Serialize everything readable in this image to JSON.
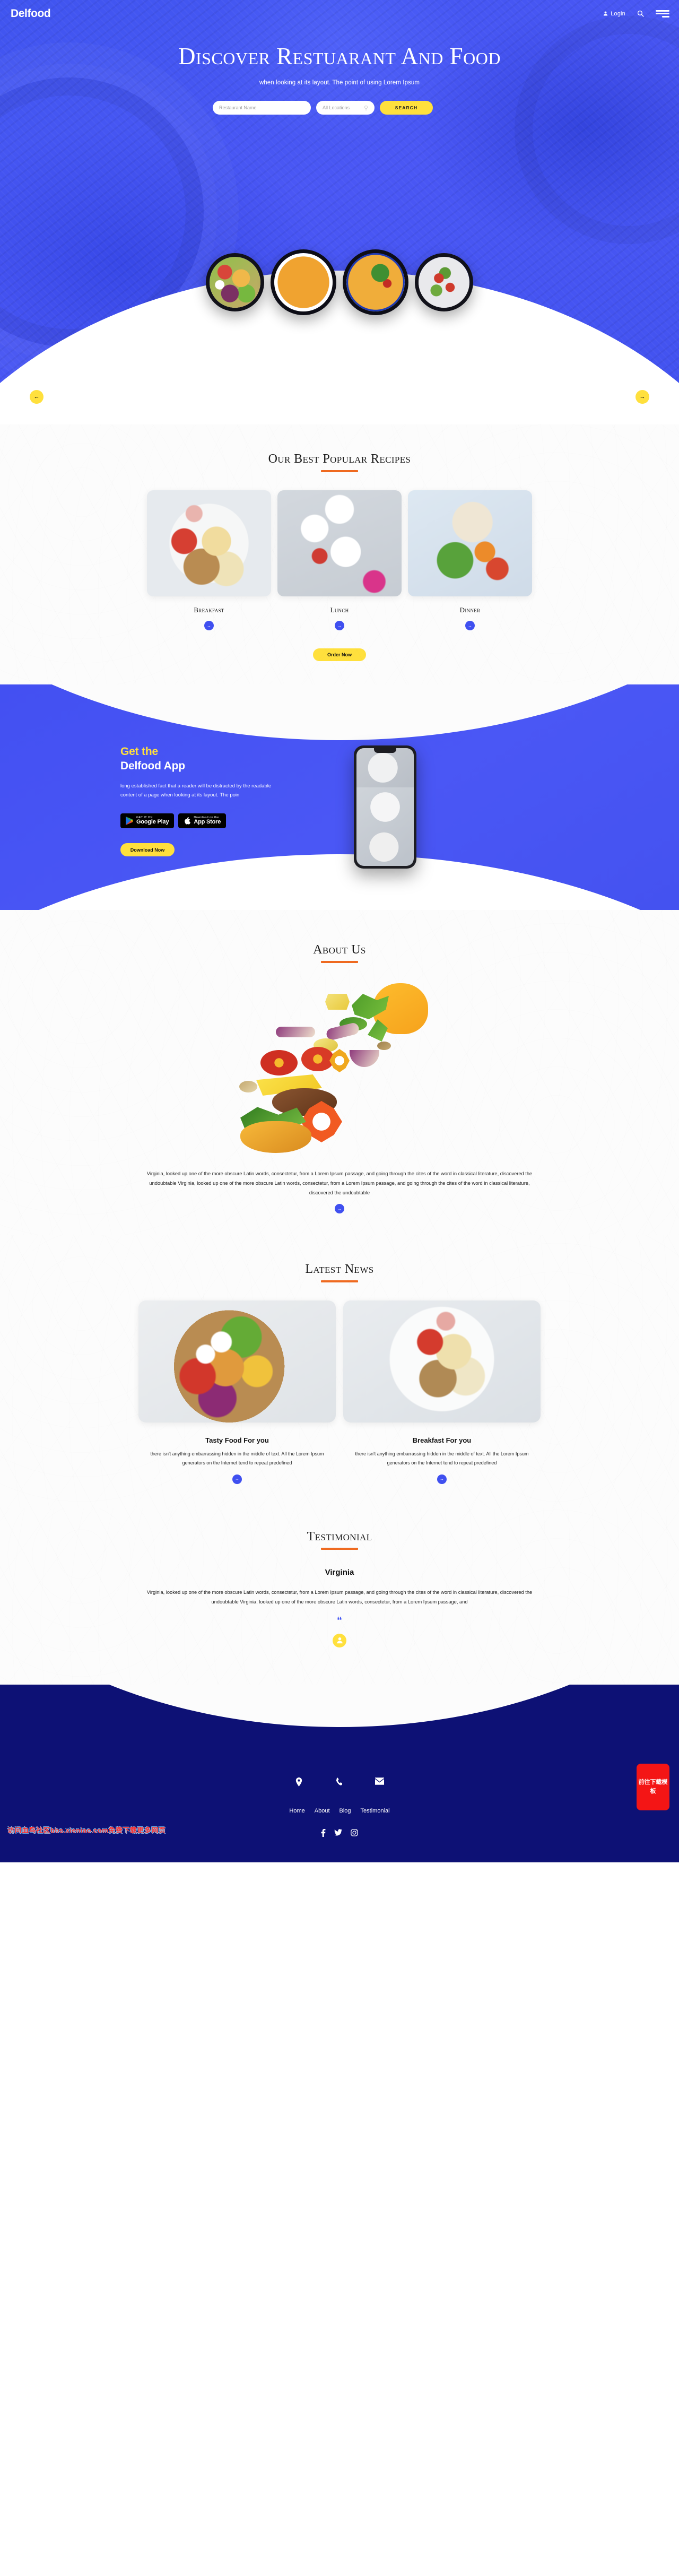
{
  "header": {
    "brand": "Delfood",
    "login_label": "Login",
    "search_icon": "search-icon",
    "menu_icon": "hamburger-menu-icon",
    "user_icon": "user-icon"
  },
  "hero": {
    "title": "Discover Restuarant And Food",
    "subtitle": "when looking at its layout. The point of using Lorem Ipsum",
    "restaurant_placeholder": "Restaurant Name",
    "location_placeholder": "All Locations",
    "location_icon": "map-pin-icon",
    "search_button": "SEARCH",
    "prev_arrow": "←",
    "next_arrow": "→"
  },
  "recipes": {
    "title": "Our Best Popular Recipes",
    "cards": [
      {
        "label": "Breakfast",
        "arrow": "→"
      },
      {
        "label": "Lunch",
        "arrow": "→"
      },
      {
        "label": "Dinner",
        "arrow": "→"
      }
    ],
    "order_button": "Order Now"
  },
  "app": {
    "heading_line1": "Get the",
    "heading_line2": "Delfood App",
    "paragraph": "long established fact that a reader will be distracted by the readable content of a page when looking at its layout. The poin",
    "google_small": "GET IT ON",
    "google_big": "Google Play",
    "apple_small": "Download on the",
    "apple_big": "App Store",
    "download_button": "Download Now",
    "accent_yellow": "#ffe03d",
    "band_blue": "#4a57f5"
  },
  "about": {
    "title": "About Us",
    "paragraph": "Virginia, looked up one of the more obscure Latin words, consectetur, from a Lorem Ipsum passage, and going through the cites of the word in classical literature, discovered the undoubtable Virginia, looked up one of the more obscure Latin words, consectetur, from a Lorem Ipsum passage, and going through the cites of the word in classical literature, discovered the undoubtable",
    "arrow": "→"
  },
  "news": {
    "title": "Latest News",
    "cards": [
      {
        "title": "Tasty Food For you",
        "desc": "there isn't anything embarrassing hidden in the middle of text. All the Lorem Ipsum generators on the Internet tend to repeat predefined",
        "arrow": "→"
      },
      {
        "title": "Breakfast For you",
        "desc": "there isn't anything embarrassing hidden in the middle of text. All the Lorem Ipsum generators on the Internet tend to repeat predefined",
        "arrow": "→"
      }
    ]
  },
  "testimonial": {
    "title": "Testimonial",
    "name": "Virginia",
    "paragraph": "Virginia, looked up one of the more obscure Latin words, consectetur, from a Lorem Ipsum passage, and going through the cites of the word in classical literature, discovered the undoubtable Virginia, looked up one of the more obscure Latin words, consectetur, from a Lorem Ipsum passage, and",
    "quote_glyph": "“",
    "avatar_icon": "user-avatar-icon"
  },
  "footer": {
    "contact_icons": [
      "map-pin-icon",
      "phone-icon",
      "envelope-icon"
    ],
    "nav": [
      "Home",
      "About",
      "Blog",
      "Testimonial"
    ],
    "social": [
      "facebook-icon",
      "twitter-icon",
      "instagram-icon"
    ],
    "bg_color": "#0d1175"
  },
  "overlays": {
    "watermark": "访问血鸟社区bbs.xieniao.com免费下载更多网页",
    "download_float": "前往下载模板"
  }
}
